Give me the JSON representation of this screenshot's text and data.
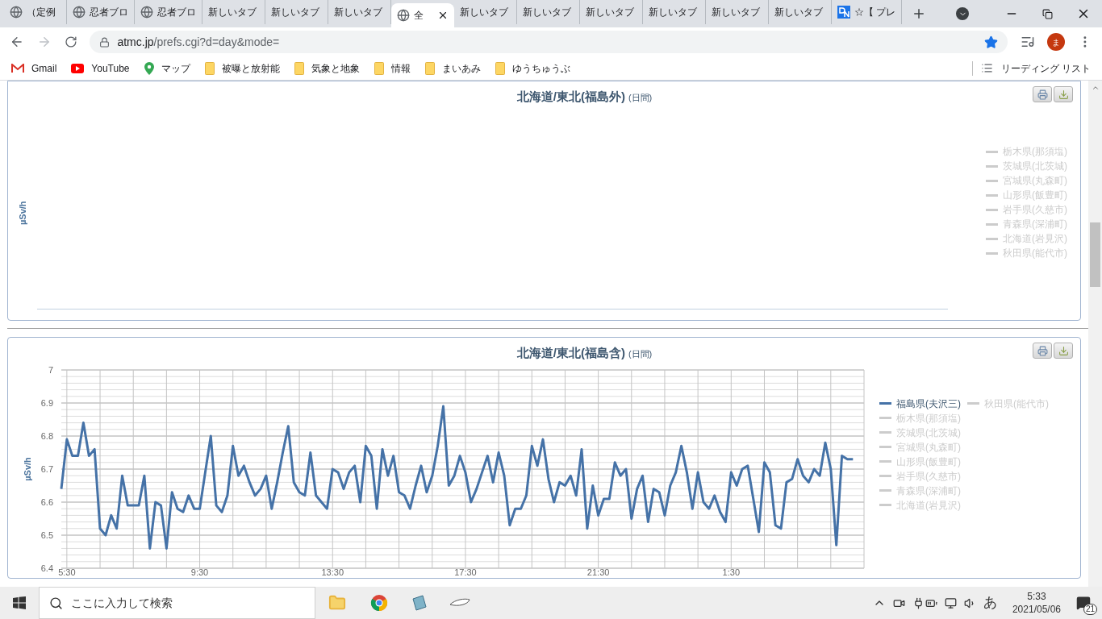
{
  "tabs": [
    {
      "label": "（定例",
      "kind": "globe",
      "selected": false
    },
    {
      "label": "忍者ブロ",
      "kind": "globe",
      "selected": false
    },
    {
      "label": "忍者ブロ",
      "kind": "globe",
      "selected": false
    },
    {
      "label": "新しいタブ",
      "kind": "plain",
      "selected": false
    },
    {
      "label": "新しいタブ",
      "kind": "plain",
      "selected": false
    },
    {
      "label": "新しいタブ",
      "kind": "plain",
      "selected": false
    },
    {
      "label": "全",
      "kind": "globe",
      "selected": true
    },
    {
      "label": "新しいタブ",
      "kind": "plain",
      "selected": false
    },
    {
      "label": "新しいタブ",
      "kind": "plain",
      "selected": false
    },
    {
      "label": "新しいタブ",
      "kind": "plain",
      "selected": false
    },
    {
      "label": "新しいタブ",
      "kind": "plain",
      "selected": false
    },
    {
      "label": "新しいタブ",
      "kind": "plain",
      "selected": false
    },
    {
      "label": "新しいタブ",
      "kind": "plain",
      "selected": false
    },
    {
      "label": "☆【 プレ",
      "kind": "site",
      "selected": false
    }
  ],
  "toolbar": {
    "url_host": "atmc.jp",
    "url_path": "/prefs.cgi?d=day&mode=",
    "bookmarked": true,
    "avatar": "ま"
  },
  "bookmarks": [
    {
      "label": "Gmail",
      "kind": "mail"
    },
    {
      "label": "YouTube",
      "kind": "video"
    },
    {
      "label": "マップ",
      "kind": "map"
    },
    {
      "label": "被曝と放射能",
      "kind": "folder"
    },
    {
      "label": "気象と地象",
      "kind": "folder"
    },
    {
      "label": "情報",
      "kind": "folder"
    },
    {
      "label": "まいあみ",
      "kind": "folder"
    },
    {
      "label": "ゆうちゅうぶ",
      "kind": "folder"
    }
  ],
  "reading_list": "リーディング リスト",
  "charts": [
    {
      "title": "北海道/東北(福島外)",
      "subtitle": "(日間)",
      "ylabel": "µSv/h",
      "legend": [
        {
          "label": "栃木県(那須塩)",
          "hidden": true
        },
        {
          "label": "茨城県(北茨城)",
          "hidden": true
        },
        {
          "label": "宮城県(丸森町)",
          "hidden": true
        },
        {
          "label": "山形県(飯豊町)",
          "hidden": true
        },
        {
          "label": "岩手県(久慈市)",
          "hidden": true
        },
        {
          "label": "青森県(深浦町)",
          "hidden": true
        },
        {
          "label": "北海道(岩見沢)",
          "hidden": true
        },
        {
          "label": "秋田県(能代市)",
          "hidden": true
        }
      ]
    },
    {
      "title": "北海道/東北(福島含)",
      "subtitle": "(日間)",
      "legend": [
        {
          "label": "秋田県(能代市)",
          "hidden": true
        },
        {
          "label": "栃木県(那須塩)",
          "hidden": true
        },
        {
          "label": "茨城県(北茨城)",
          "hidden": true
        },
        {
          "label": "宮城県(丸森町)",
          "hidden": true
        },
        {
          "label": "山形県(飯豊町)",
          "hidden": true
        },
        {
          "label": "岩手県(久慈市)",
          "hidden": true
        },
        {
          "label": "青森県(深浦町)",
          "hidden": true
        },
        {
          "label": "北海道(岩見沢)",
          "hidden": true
        }
      ],
      "chart_data": {
        "type": "line",
        "ylabel": "µSv/h",
        "grid": true,
        "ylim": [
          6.4,
          7
        ],
        "yticks": [
          6.4,
          6.5,
          6.6,
          6.7,
          6.8,
          6.9,
          7
        ],
        "categories": [
          null,
          "5:30",
          null,
          null,
          null,
          null,
          null,
          null,
          null,
          null,
          null,
          null,
          null,
          null,
          null,
          null,
          null,
          null,
          null,
          null,
          null,
          null,
          null,
          null,
          null,
          "9:30",
          null,
          null,
          null,
          null,
          null,
          null,
          null,
          null,
          null,
          null,
          null,
          null,
          null,
          null,
          null,
          null,
          null,
          null,
          null,
          null,
          null,
          null,
          null,
          "13:30",
          null,
          null,
          null,
          null,
          null,
          null,
          null,
          null,
          null,
          null,
          null,
          null,
          null,
          null,
          null,
          null,
          null,
          null,
          null,
          null,
          null,
          null,
          null,
          "17:30",
          null,
          null,
          null,
          null,
          null,
          null,
          null,
          null,
          null,
          null,
          null,
          null,
          null,
          null,
          null,
          null,
          null,
          null,
          null,
          null,
          null,
          null,
          null,
          "21:30",
          null,
          null,
          null,
          null,
          null,
          null,
          null,
          null,
          null,
          null,
          null,
          null,
          null,
          null,
          null,
          null,
          null,
          null,
          null,
          null,
          null,
          null,
          null,
          "1:30",
          null,
          null,
          null,
          null,
          null,
          null,
          null,
          null,
          null,
          null,
          null,
          null,
          null,
          null,
          null,
          null,
          null,
          null,
          null,
          null,
          null,
          null
        ],
        "series": [
          {
            "name": "福島県(夫沢三)",
            "color": "#4572a7",
            "values": [
              6.64,
              6.79,
              6.74,
              6.74,
              6.84,
              6.74,
              6.76,
              6.52,
              6.5,
              6.56,
              6.52,
              6.68,
              6.59,
              6.59,
              6.59,
              6.68,
              6.46,
              6.6,
              6.59,
              6.46,
              6.63,
              6.58,
              6.57,
              6.62,
              6.58,
              6.58,
              6.69,
              6.8,
              6.59,
              6.57,
              6.62,
              6.77,
              6.68,
              6.71,
              6.66,
              6.62,
              6.64,
              6.68,
              6.58,
              6.66,
              6.75,
              6.83,
              6.66,
              6.63,
              6.62,
              6.75,
              6.62,
              6.6,
              6.58,
              6.7,
              6.69,
              6.64,
              6.69,
              6.71,
              6.6,
              6.77,
              6.74,
              6.58,
              6.76,
              6.68,
              6.74,
              6.63,
              6.62,
              6.58,
              6.65,
              6.71,
              6.63,
              6.68,
              6.77,
              6.89,
              6.65,
              6.68,
              6.74,
              6.69,
              6.6,
              6.64,
              6.69,
              6.74,
              6.66,
              6.75,
              6.68,
              6.53,
              6.58,
              6.58,
              6.62,
              6.77,
              6.71,
              6.79,
              6.67,
              6.6,
              6.66,
              6.65,
              6.68,
              6.62,
              6.76,
              6.52,
              6.65,
              6.56,
              6.61,
              6.61,
              6.72,
              6.68,
              6.7,
              6.55,
              6.64,
              6.68,
              6.54,
              6.64,
              6.63,
              6.56,
              6.65,
              6.69,
              6.77,
              6.69,
              6.58,
              6.69,
              6.6,
              6.58,
              6.62,
              6.57,
              6.54,
              6.69,
              6.65,
              6.7,
              6.71,
              6.61,
              6.51,
              6.72,
              6.69,
              6.53,
              6.52,
              6.66,
              6.67,
              6.73,
              6.68,
              6.66,
              6.7,
              6.68,
              6.78,
              6.7,
              6.47,
              6.74,
              6.73,
              6.73
            ]
          }
        ]
      }
    }
  ],
  "taskbar": {
    "search_placeholder": "ここに入力して検索",
    "ime": "あ",
    "time": "5:33",
    "date": "2021/05/06",
    "notifications": "21"
  }
}
